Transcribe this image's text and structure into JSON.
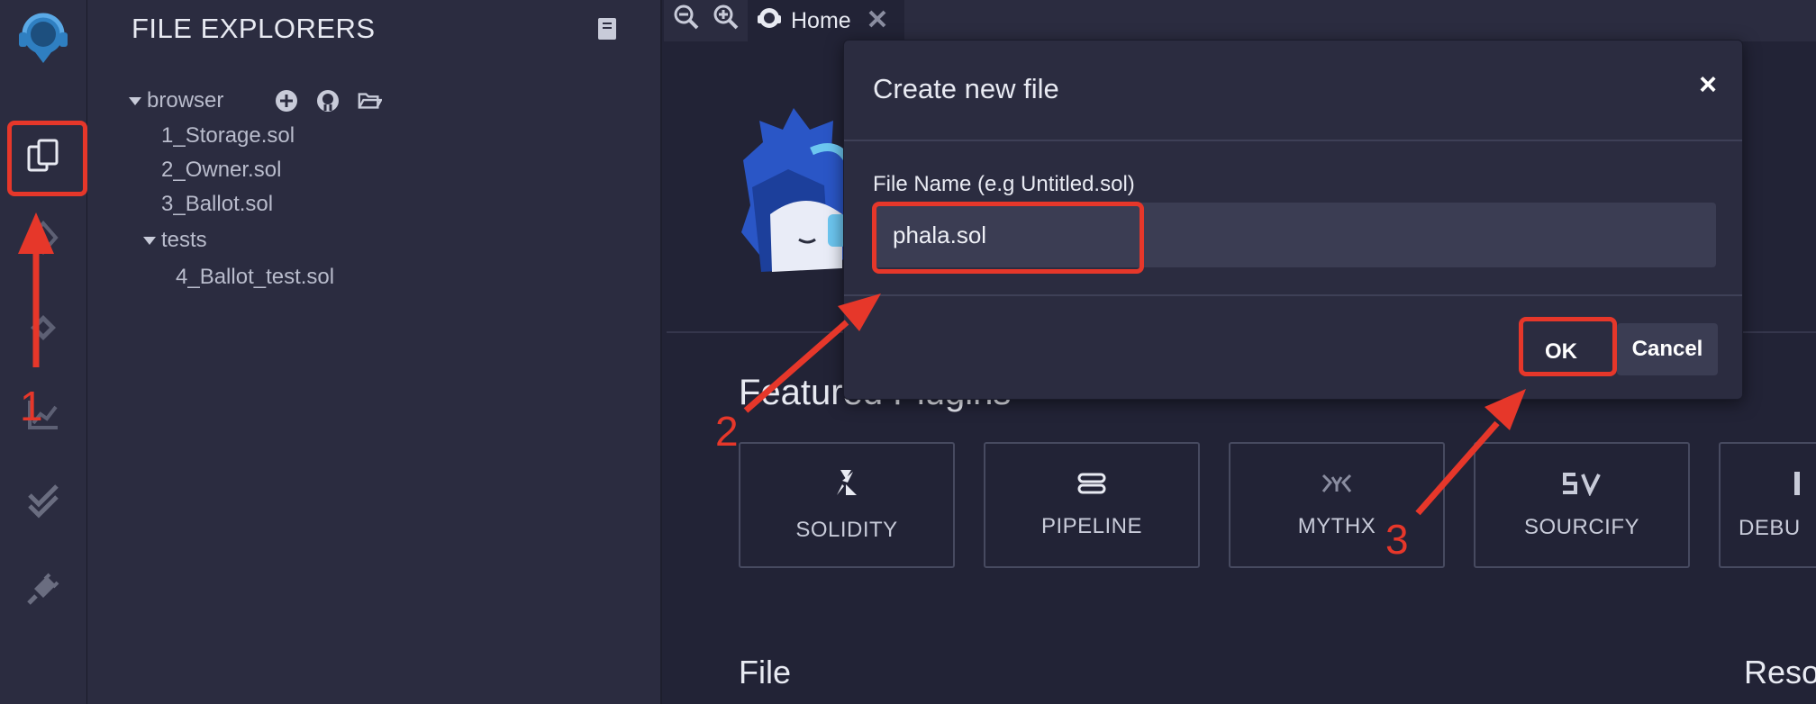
{
  "explorer": {
    "title": "FILE EXPLORERS",
    "root_folder": "browser",
    "files": [
      "1_Storage.sol",
      "2_Owner.sol",
      "3_Ballot.sol"
    ],
    "subfolder": "tests",
    "subfolder_files": [
      "4_Ballot_test.sol"
    ]
  },
  "tabs": {
    "home_label": "Home"
  },
  "home": {
    "featured_title": "Featured Plugins",
    "plugins": [
      "SOLIDITY",
      "PIPELINE",
      "MYTHX",
      "SOURCIFY",
      "DEBU"
    ],
    "file_heading": "File",
    "resources_heading": "Reso"
  },
  "modal": {
    "title": "Create new file",
    "close_glyph": "×",
    "field_label": "File Name (e.g Untitled.sol)",
    "input_value": "phala.sol",
    "ok_label": "OK",
    "cancel_label": "Cancel"
  },
  "annotations": {
    "step1": "1",
    "step2": "2",
    "step3": "3",
    "color": "#e6372a"
  },
  "colors": {
    "background": "#222336",
    "panel": "#2b2c40",
    "input": "#3b3d53",
    "accent": "#2f7fc1"
  },
  "icons": [
    "remix-logo-icon",
    "file-explorer-icon",
    "compiler-icon",
    "deploy-icon",
    "analysis-icon",
    "test-icon",
    "plugin-manager-icon",
    "docs-icon",
    "add-file-icon",
    "github-icon",
    "open-folder-icon",
    "zoom-out-icon",
    "zoom-in-icon",
    "home-tab-icon",
    "close-tab-icon"
  ]
}
